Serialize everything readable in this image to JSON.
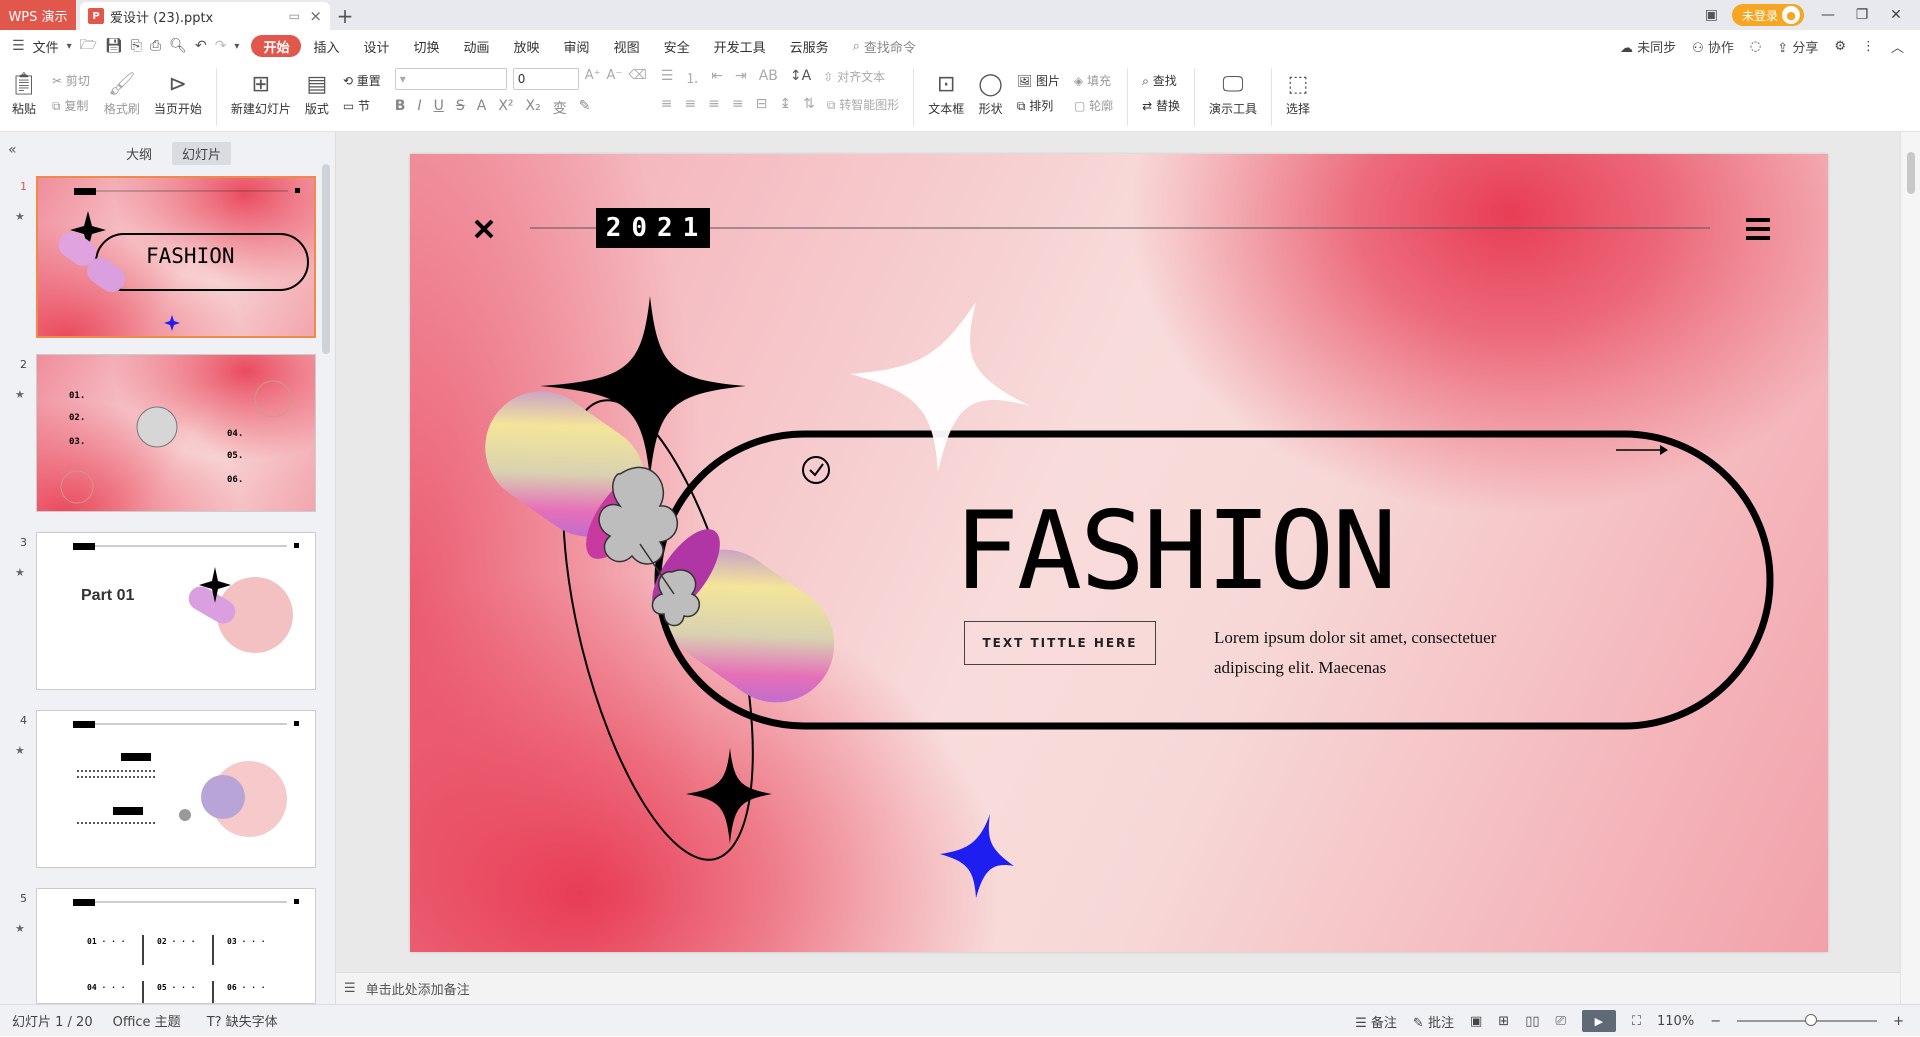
{
  "titlebar": {
    "app_tab": "WPS 演示",
    "doc_tab": "爱设计 (23).pptx",
    "new_tab": "+",
    "login": "未登录",
    "win_min": "—",
    "win_restore": "❐",
    "win_close": "✕"
  },
  "menubar": {
    "file": "文件",
    "tabs": [
      "开始",
      "插入",
      "设计",
      "切换",
      "动画",
      "放映",
      "审阅",
      "视图",
      "安全",
      "开发工具",
      "云服务"
    ],
    "search": "查找命令",
    "sync": "未同步",
    "collab": "协作",
    "share": "分享"
  },
  "ribbon": {
    "paste": "粘贴",
    "cut": "剪切",
    "copy": "复制",
    "format_painter": "格式刷",
    "start_from": "当页开始",
    "new_slide": "新建幻灯片",
    "layout": "版式",
    "reset": "重置",
    "section": "节",
    "font_size": "0",
    "align_text": "对齐文本",
    "smart_shape": "转智能图形",
    "textbox": "文本框",
    "shape": "形状",
    "picture": "图片",
    "arrange": "排列",
    "fill": "填充",
    "outline": "轮廓",
    "find": "查找",
    "replace": "替换",
    "present_tools": "演示工具",
    "select": "选择"
  },
  "left_panel": {
    "tab_outline": "大纲",
    "tab_slides": "幻灯片",
    "thumbs": [
      {
        "num": "1",
        "title": "FASHION"
      },
      {
        "num": "2",
        "items": [
          "01.",
          "02.",
          "03.",
          "04.",
          "05.",
          "06."
        ]
      },
      {
        "num": "3",
        "title": "Part 01"
      },
      {
        "num": "4"
      },
      {
        "num": "5",
        "items": [
          "01 · · ·",
          "02 · · ·",
          "03 · · ·",
          "04 · · ·",
          "05 · · ·",
          "06 · · ·"
        ]
      }
    ]
  },
  "slide": {
    "year": "2021",
    "title": "FASHION",
    "button_text": "TEXT TITTLE HERE",
    "body": "Lorem ipsum dolor sit amet, consectetuer adipiscing elit. Maecenas"
  },
  "notes": {
    "placeholder": "单击此处添加备注"
  },
  "status": {
    "slide_counter": "幻灯片 1 / 20",
    "theme": "Office 主题",
    "missing_font": "缺失字体",
    "notes_btn": "备注",
    "comments_btn": "批注",
    "zoom": "110%"
  },
  "colors": {
    "accent": "#e2574c",
    "slide_pink": "#f3a9b2",
    "slide_red": "#e83d55",
    "star_blue": "#1e1ef0"
  }
}
